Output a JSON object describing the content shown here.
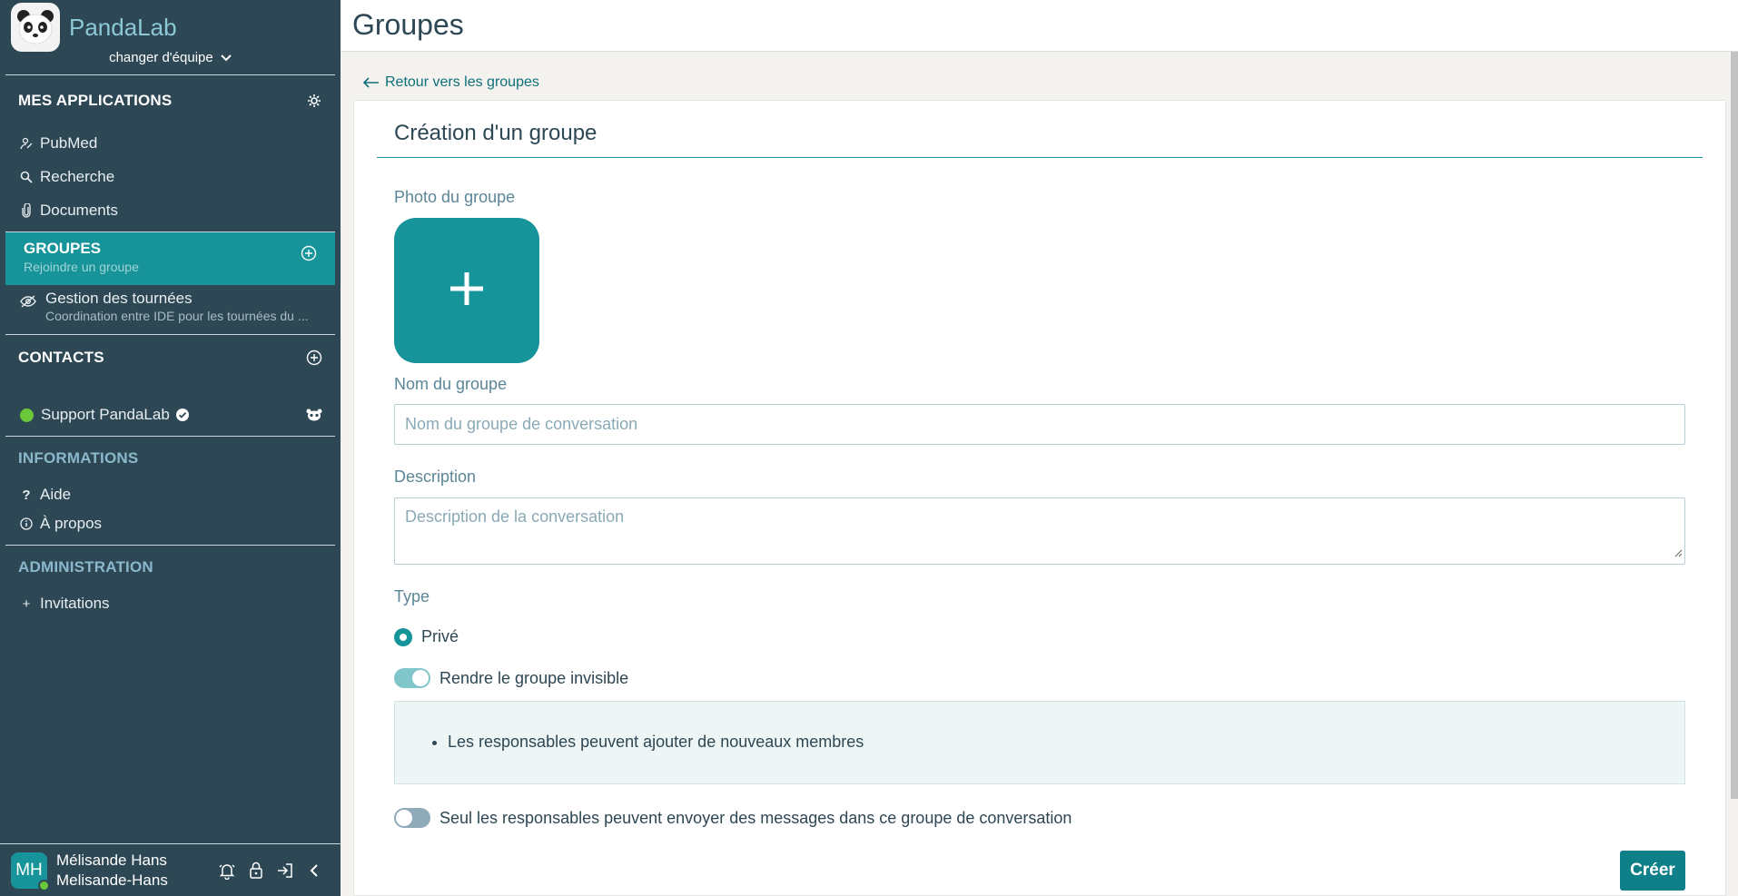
{
  "app": {
    "brand_name": "PandaLab",
    "team_switch_label": "changer d'équipe"
  },
  "sidebar": {
    "my_apps": {
      "title": "MES APPLICATIONS",
      "items": [
        {
          "label": "PubMed",
          "icon": "pubmed-icon"
        },
        {
          "label": "Recherche",
          "icon": "search-icon"
        },
        {
          "label": "Documents",
          "icon": "paperclip-icon"
        }
      ]
    },
    "groups": {
      "title": "GROUPES",
      "subtitle": "Rejoindre un groupe",
      "items": [
        {
          "name": "Gestion des tournées",
          "description": "Coordination entre IDE pour les tournées du ..."
        }
      ]
    },
    "contacts": {
      "title": "CONTACTS",
      "items": [
        {
          "name": "Support PandaLab",
          "status": "online"
        }
      ]
    },
    "informations": {
      "title": "INFORMATIONS",
      "items": [
        {
          "label": "Aide"
        },
        {
          "label": "À propos"
        }
      ]
    },
    "administration": {
      "title": "ADMINISTRATION",
      "items": [
        {
          "label": "Invitations"
        }
      ]
    },
    "user": {
      "initials": "MH",
      "display_name": "Mélisande Hans",
      "username": "Melisande-Hans"
    }
  },
  "header": {
    "title": "Groupes"
  },
  "main": {
    "back_link": "Retour vers les groupes",
    "form_title": "Création d'un groupe",
    "photo_label": "Photo du groupe",
    "name_label": "Nom du groupe",
    "name_placeholder": "Nom du groupe de conversation",
    "description_label": "Description",
    "description_placeholder": "Description de la conversation",
    "type_label": "Type",
    "type_option": "Privé",
    "invisible_toggle_label": "Rendre le groupe invisible",
    "invisible_toggle_on": true,
    "info_items": [
      "Les responsables peuvent ajouter de nouveaux membres"
    ],
    "admins_only_toggle_label": "Seul les responsables peuvent envoyer des messages dans ce groupe de conversation",
    "admins_only_toggle_on": false,
    "submit_label": "Créer"
  },
  "colors": {
    "sidebar_bg": "#2d4754",
    "accent": "#17939a",
    "brand_text": "#8cc8d6",
    "online": "#6ac73a"
  }
}
